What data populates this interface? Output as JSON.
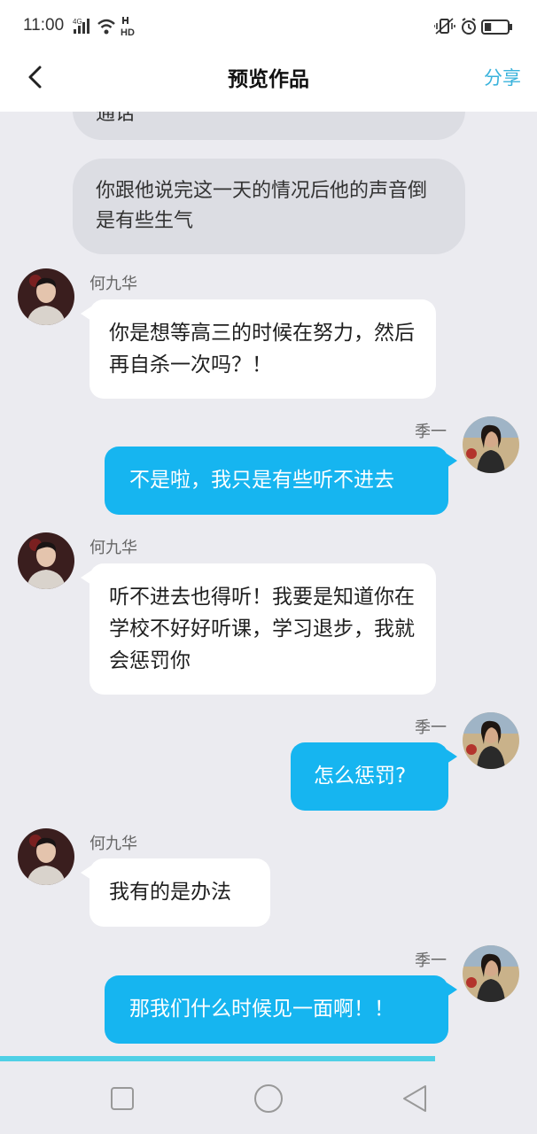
{
  "status_bar": {
    "time": "11:00",
    "network": "4G",
    "hd": "HD",
    "icons": [
      "signal-icon",
      "wifi-icon",
      "hd-icon",
      "vibrate-icon",
      "alarm-icon",
      "battery-icon"
    ],
    "battery_level": 0.3
  },
  "header": {
    "title": "预览作品",
    "share_label": "分享",
    "back_icon": "chevron-left-icon"
  },
  "chat": {
    "partial_narration": "通话",
    "narration": "你跟他说完这一天的情况后他的声音倒是有些生气",
    "messages": [
      {
        "sender": "何九华",
        "side": "left",
        "text": "你是想等高三的时候在努力，然后再自杀一次吗？！"
      },
      {
        "sender": "季一",
        "side": "right",
        "text": "不是啦，我只是有些听不进去"
      },
      {
        "sender": "何九华",
        "side": "left",
        "text": "听不进去也得听！我要是知道你在学校不好好听课，学习退步，我就会惩罚你"
      },
      {
        "sender": "季一",
        "side": "right",
        "text": "怎么惩罚?"
      },
      {
        "sender": "何九华",
        "side": "left",
        "text": "我有的是办法"
      },
      {
        "sender": "季一",
        "side": "right",
        "text": "那我们什么时候见一面啊！！"
      }
    ]
  },
  "progress": {
    "value": 0.81
  },
  "colors": {
    "accent": "#16b5f0",
    "share": "#3ab3dc",
    "progress": "#4fd0e6",
    "background": "#ebebf0",
    "narration_bg": "#dcdde3"
  },
  "system_nav": {
    "icons": [
      "recent-apps-icon",
      "home-icon",
      "back-triangle-icon"
    ]
  }
}
